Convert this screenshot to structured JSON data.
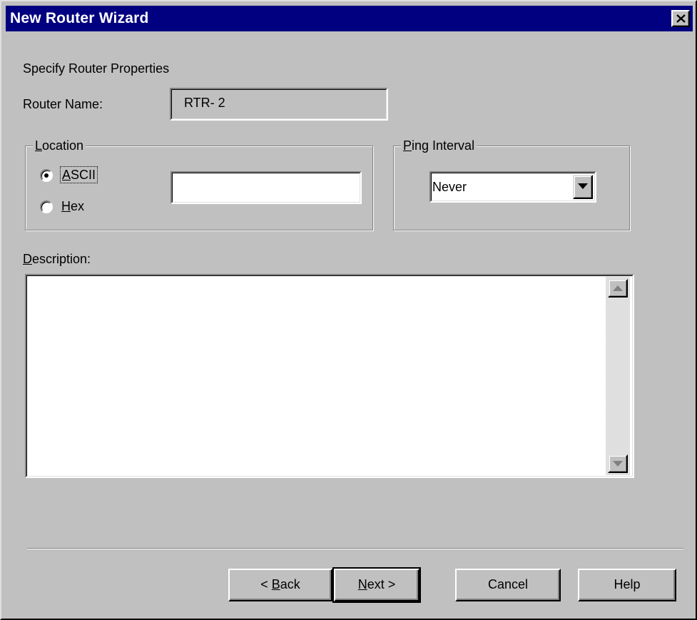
{
  "window": {
    "title": "New Router Wizard",
    "close_label": "×"
  },
  "page": {
    "heading": "Specify Router Properties"
  },
  "router_name": {
    "label": "Router Name:",
    "value": "RTR- 2"
  },
  "location": {
    "group_title_mnemonic": "L",
    "group_title_rest": "ocation",
    "options": [
      {
        "mnemonic": "",
        "pre": "A",
        "label_rest": "SCII",
        "selected": true
      },
      {
        "mnemonic": "H",
        "pre": "",
        "label_rest": "ex",
        "selected": false
      }
    ],
    "value": ""
  },
  "ping_interval": {
    "group_title_mnemonic": "P",
    "group_title_rest": "ing Interval",
    "selected": "Never"
  },
  "description": {
    "label_mnemonic": "D",
    "label_rest": "escription:",
    "value": ""
  },
  "buttons": {
    "back_pre": "< ",
    "back_mnemonic": "B",
    "back_rest": "ack",
    "next_mnemonic": "N",
    "next_rest": "ext >",
    "cancel": "Cancel",
    "help": "Help"
  }
}
